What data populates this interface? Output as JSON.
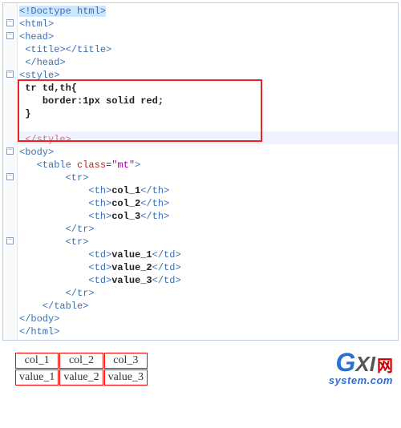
{
  "gutter_icons": [
    "",
    "-",
    "-",
    "",
    "",
    "-",
    "",
    "",
    "",
    "",
    "",
    "",
    "-",
    "",
    "-",
    "",
    "",
    "",
    "",
    "-",
    "",
    "",
    "",
    "",
    "",
    ""
  ],
  "code": {
    "doctype_open": "<",
    "doctype_text": "!Doctype html",
    "doctype_close": ">",
    "html_open": "<html>",
    "head_open": "<head>",
    "title_line": "<title></title>",
    "head_close": "</head>",
    "style_open": "<style>",
    "css_selector": "tr td,th{",
    "css_rule_indent": "    ",
    "css_prop": "border:1px solid red;",
    "css_close": "}",
    "style_close": "</style>",
    "body_open": "<body>",
    "table_open_pre": "   <table ",
    "table_attr": "class",
    "table_eq": "=",
    "table_val": "\"mt\"",
    "table_open_post": ">",
    "tr_open": "        <tr>",
    "th1_pre": "            <th>",
    "th1_text": "col_1",
    "th1_post": "</th>",
    "th2_pre": "            <th>",
    "th2_text": "col_2",
    "th2_post": "</th>",
    "th3_pre": "            <th>",
    "th3_text": "col_3",
    "th3_post": "</th>",
    "tr_close": "        </tr>",
    "tr2_open": "        <tr>",
    "td1_pre": "            <td>",
    "td1_text": "value_1",
    "td1_post": "</td>",
    "td2_pre": "            <td>",
    "td2_text": "value_2",
    "td2_post": "</td>",
    "td3_pre": "            <td>",
    "td3_text": "value_3",
    "td3_post": "</td>",
    "tr2_close": "        </tr>",
    "table_close": "    </table>",
    "body_close": "</body>",
    "html_close": "</html>"
  },
  "rendered": {
    "headers": [
      "col_1",
      "col_2",
      "col_3"
    ],
    "values": [
      "value_1",
      "value_2",
      "value_3"
    ]
  },
  "logo": {
    "g": "G",
    "xi": "XI",
    "net": "网",
    "sub": "system.com"
  }
}
